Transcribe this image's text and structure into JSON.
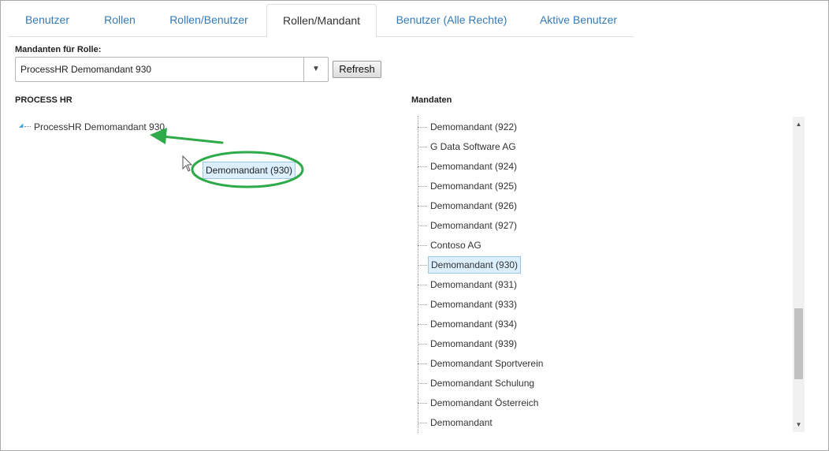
{
  "tabs": [
    {
      "label": "Benutzer",
      "active": false
    },
    {
      "label": "Rollen",
      "active": false
    },
    {
      "label": "Rollen/Benutzer",
      "active": false
    },
    {
      "label": "Rollen/Mandant",
      "active": true
    },
    {
      "label": "Benutzer (Alle Rechte)",
      "active": false
    },
    {
      "label": "Aktive Benutzer",
      "active": false
    }
  ],
  "role_field": {
    "label": "Mandanten für Rolle:",
    "selected": "ProcessHR Demomandant 930"
  },
  "refresh_label": "Refresh",
  "left_panel": {
    "title": "PROCESS HR",
    "tree": {
      "label": "ProcessHR Demomandant 930"
    },
    "drag_item": "Demomandant (930)"
  },
  "right_panel": {
    "title": "Mandaten",
    "items": [
      {
        "label": "Demomandant (922)"
      },
      {
        "label": "G Data Software AG"
      },
      {
        "label": "Demomandant (924)"
      },
      {
        "label": "Demomandant (925)"
      },
      {
        "label": "Demomandant (926)"
      },
      {
        "label": "Demomandant (927)"
      },
      {
        "label": "Contoso AG"
      },
      {
        "label": "Demomandant (930)",
        "selected": true
      },
      {
        "label": "Demomandant (931)"
      },
      {
        "label": "Demomandant (933)"
      },
      {
        "label": "Demomandant (934)"
      },
      {
        "label": "Demomandant (939)"
      },
      {
        "label": "Demomandant Sportverein"
      },
      {
        "label": "Demomandant Schulung"
      },
      {
        "label": "Demomandant Österreich"
      },
      {
        "label": "Demomandant"
      }
    ]
  },
  "colors": {
    "tab_link": "#337ab7",
    "selection_bg": "#dcefff",
    "selection_border": "#9cc6e8",
    "annotation": "#2eaa4a"
  },
  "icons": {
    "tree_toggle": "expanded-triangle-icon",
    "select_arrow": "caret-down-icon",
    "cursor": "mouse-pointer-icon",
    "annotation_arrow": "green-arrow-icon",
    "annotation_ellipse": "green-ellipse-highlight"
  }
}
